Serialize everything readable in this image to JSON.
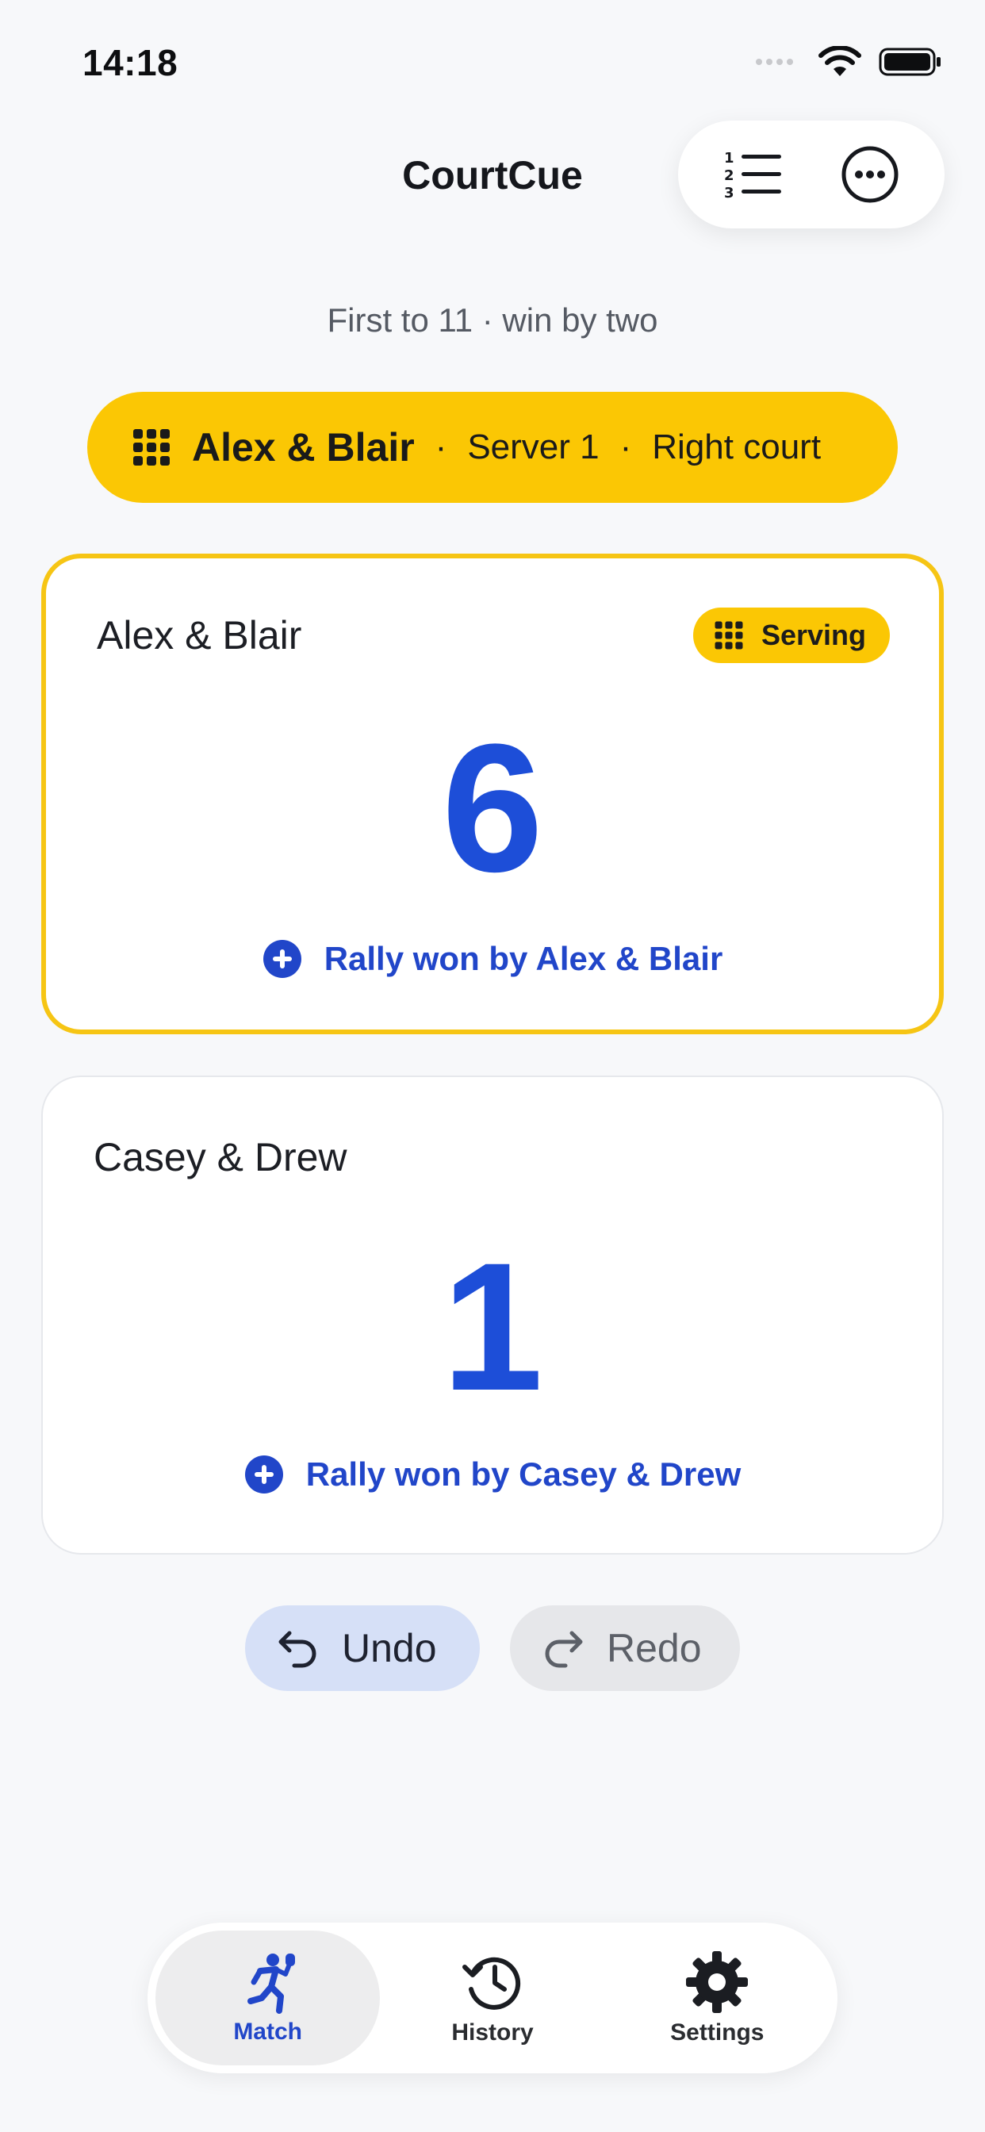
{
  "status": {
    "time": "14:18"
  },
  "header": {
    "title": "CourtCue"
  },
  "rules_text": "First to 11 · win by two",
  "serve_info": {
    "team": "Alex & Blair",
    "sep": "·",
    "server": "Server 1",
    "court": "Right court"
  },
  "teams": [
    {
      "name": "Alex & Blair",
      "score": "6",
      "badge": "Serving",
      "rally_label": "Rally won by Alex & Blair"
    },
    {
      "name": "Casey & Drew",
      "score": "1",
      "rally_label": "Rally won by Casey & Drew"
    }
  ],
  "actions": {
    "undo": "Undo",
    "redo": "Redo"
  },
  "tabs": [
    {
      "label": "Match",
      "icon": "player-running-icon"
    },
    {
      "label": "History",
      "icon": "history-icon"
    },
    {
      "label": "Settings",
      "icon": "gear-icon"
    }
  ],
  "colors": {
    "accent": "#1d4ed8",
    "serve_yellow": "#fbc704",
    "background": "#f7f8fa"
  }
}
